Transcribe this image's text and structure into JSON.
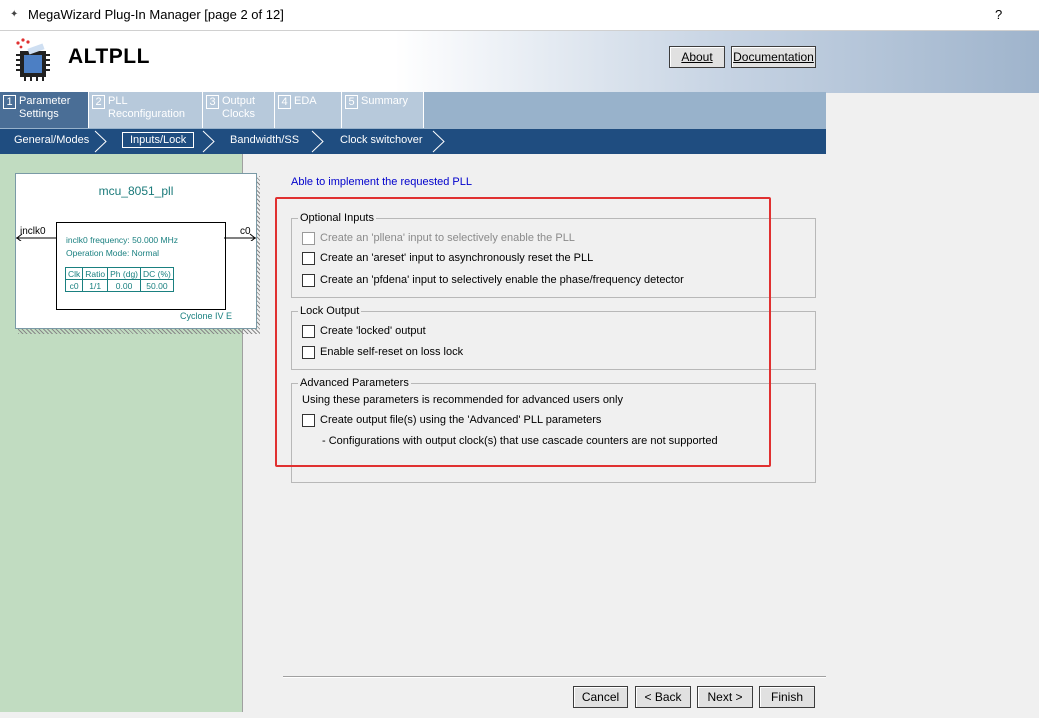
{
  "window": {
    "title": "MegaWizard Plug-In Manager [page 2 of 12]",
    "help_label": "?"
  },
  "header": {
    "app_title": "ALTPLL",
    "about_label": "About",
    "documentation_label": "Documentation"
  },
  "tabs": [
    {
      "num": "1",
      "label_line1": "Parameter",
      "label_line2": "Settings"
    },
    {
      "num": "2",
      "label_line1": "PLL",
      "label_line2": "Reconfiguration"
    },
    {
      "num": "3",
      "label_line1": "Output",
      "label_line2": "Clocks"
    },
    {
      "num": "4",
      "label_line1": "EDA",
      "label_line2": ""
    },
    {
      "num": "5",
      "label_line1": "Summary",
      "label_line2": ""
    }
  ],
  "steps": [
    "General/Modes",
    "Inputs/Lock",
    "Bandwidth/SS",
    "Clock switchover"
  ],
  "diagram": {
    "title": "mcu_8051_pll",
    "input_pin": "inclk0",
    "output_pin": "c0",
    "freq_text": "inclk0 frequency: 50.000 MHz",
    "mode_text": "Operation Mode: Normal",
    "table_headers": [
      "Clk",
      "Ratio",
      "Ph (dg)",
      "DC (%)"
    ],
    "table_row": [
      "c0",
      "1/1",
      "0.00",
      "50.00"
    ],
    "device": "Cyclone IV E"
  },
  "status_text": "Able to implement the requested PLL",
  "optional_inputs": {
    "legend": "Optional Inputs",
    "items": [
      "Create an 'pllena' input to selectively enable the PLL",
      "Create an 'areset' input to asynchronously reset the PLL",
      "Create an 'pfdena' input to selectively enable the phase/frequency detector"
    ]
  },
  "lock_output": {
    "legend": "Lock Output",
    "items": [
      "Create 'locked' output",
      "Enable self-reset on loss lock"
    ]
  },
  "advanced": {
    "legend": "Advanced Parameters",
    "note": "Using these parameters is recommended for advanced users only",
    "item": "Create output file(s) using the 'Advanced' PLL parameters",
    "sub_note": "- Configurations with output clock(s) that use cascade counters are not supported"
  },
  "footer": {
    "cancel": "Cancel",
    "back": "< Back",
    "next": "Next >",
    "finish": "Finish"
  }
}
